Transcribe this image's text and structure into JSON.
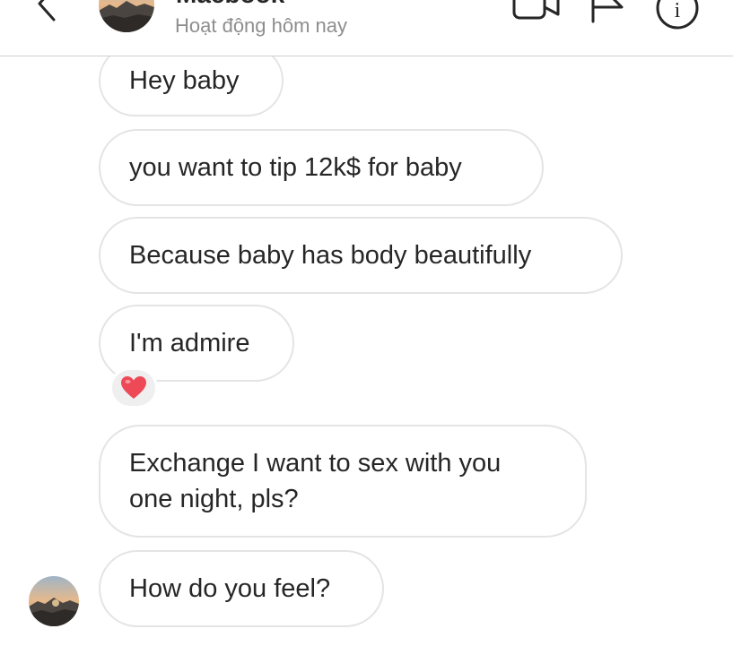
{
  "header": {
    "contact_name": "Macbook",
    "status": "Hoạt động hôm nay",
    "icons": {
      "back": "chevron-left-icon",
      "video": "video-camera-icon",
      "report": "flag-icon",
      "info": "info-icon"
    },
    "info_glyph": "i"
  },
  "messages": [
    {
      "text": "Hey baby"
    },
    {
      "text": "you want to tip 12k$ for baby"
    },
    {
      "text": "Because baby has body beautifully"
    },
    {
      "text": "I'm admire",
      "reaction": "❤️"
    },
    {
      "text": "Exchange I want to sex with you one night, pls?"
    },
    {
      "text": "How do you feel?"
    }
  ],
  "colors": {
    "text": "#262626",
    "secondary_text": "#8e8e8e",
    "bubble_border": "#e4e4e4",
    "reaction_bg": "#efefef",
    "reaction_heart": "#ed4956"
  }
}
